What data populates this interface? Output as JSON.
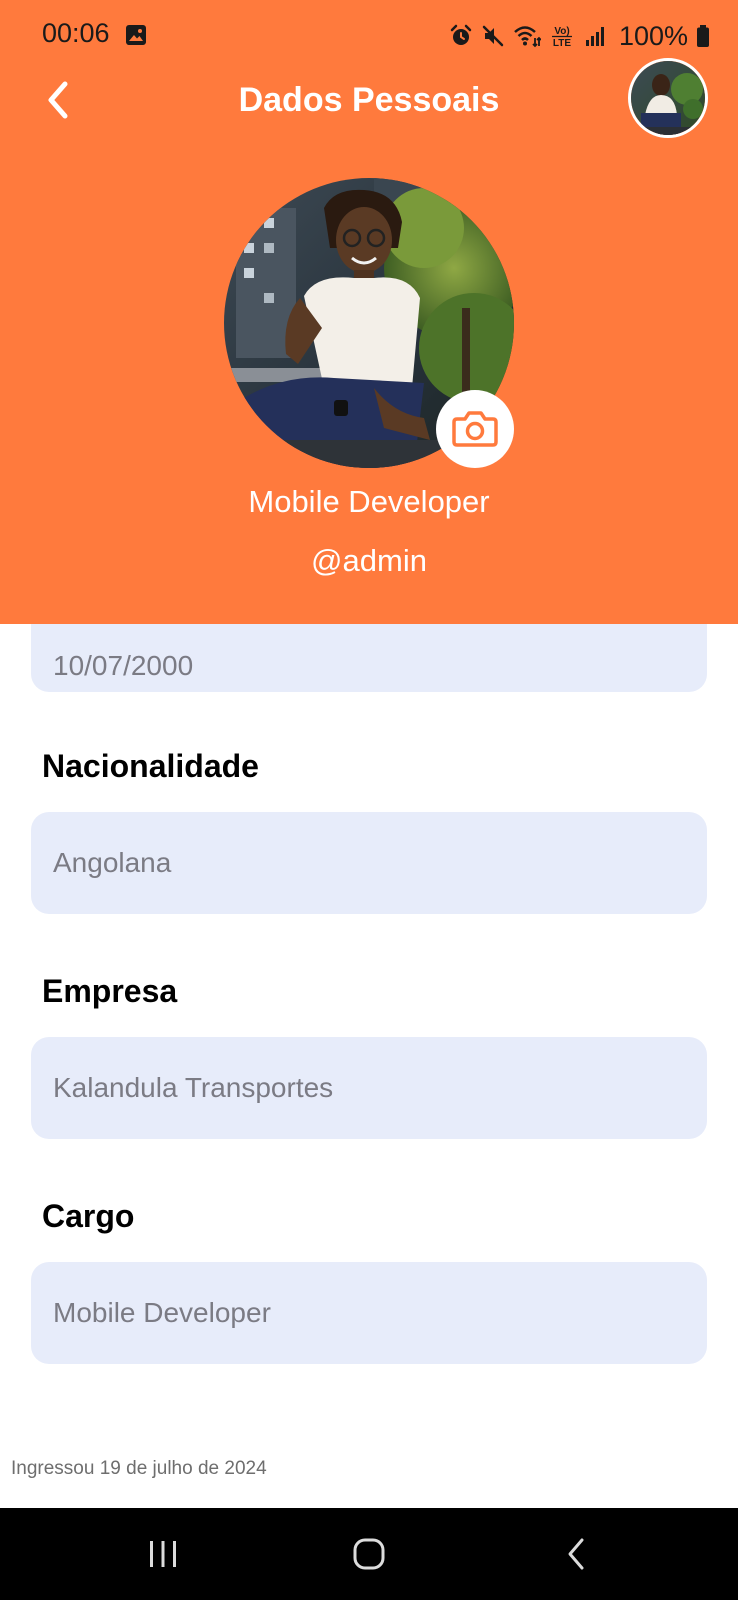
{
  "status_bar": {
    "time": "00:06",
    "battery": "100%",
    "icons": [
      "gallery-icon",
      "alarm-icon",
      "mute-icon",
      "wifi-icon",
      "volte-icon",
      "signal-icon",
      "battery-icon"
    ],
    "volte_label_top": "Vo)",
    "volte_label_bottom": "LTE"
  },
  "header": {
    "title": "Dados Pessoais",
    "back_icon": "chevron-left-icon",
    "background_color": "#FF7A3D"
  },
  "profile": {
    "role": "Mobile Developer",
    "username": "@admin",
    "camera_icon": "camera-icon"
  },
  "form": {
    "fields": [
      {
        "label": "",
        "value": "10/07/2000"
      },
      {
        "label": "Nacionalidade",
        "value": "Angolana"
      },
      {
        "label": "Empresa",
        "value": "Kalandula Transportes"
      },
      {
        "label": "Cargo",
        "value": "Mobile Developer"
      }
    ],
    "field_background": "#E7ECFA"
  },
  "footer": {
    "joined": "Ingressou 19 de julho de 2024"
  },
  "nav_bar": {
    "icons": [
      "recent-apps-icon",
      "home-icon",
      "back-icon"
    ]
  }
}
